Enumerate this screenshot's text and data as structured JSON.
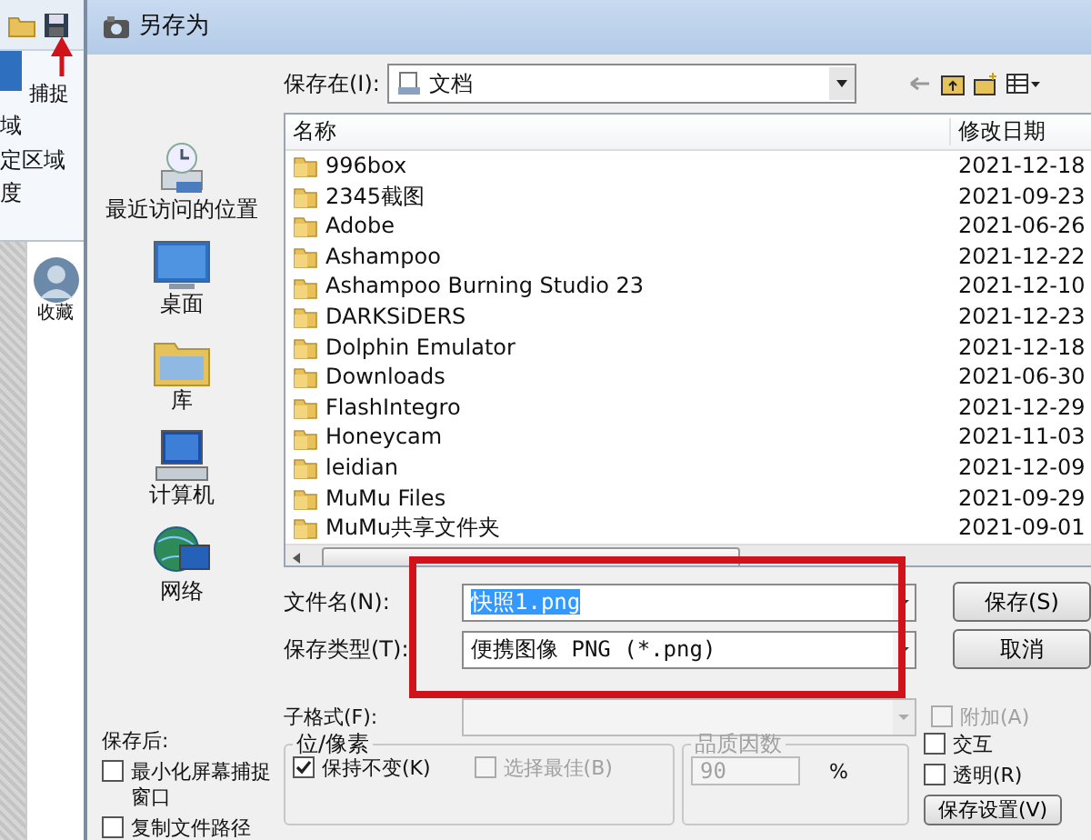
{
  "background_app": {
    "ribbon_texts": [
      "捕捉",
      "域",
      "定区域",
      "度"
    ],
    "panel_caption": "收藏"
  },
  "dialog": {
    "title": "另存为",
    "save_in": {
      "label": "保存在(I):",
      "value": "文档"
    },
    "places": [
      {
        "label": "最近访问的位置",
        "kind": "recent"
      },
      {
        "label": "桌面",
        "kind": "desktop"
      },
      {
        "label": "库",
        "kind": "library"
      },
      {
        "label": "计算机",
        "kind": "computer"
      },
      {
        "label": "网络",
        "kind": "network"
      }
    ],
    "file_list": {
      "columns": [
        "名称",
        "修改日期"
      ],
      "rows": [
        {
          "name": "996box",
          "date": "2021-12-18"
        },
        {
          "name": "2345截图",
          "date": "2021-09-23"
        },
        {
          "name": "Adobe",
          "date": "2021-06-26"
        },
        {
          "name": "Ashampoo",
          "date": "2021-12-22"
        },
        {
          "name": "Ashampoo Burning Studio 23",
          "date": "2021-12-10"
        },
        {
          "name": "DARKSiDERS",
          "date": "2021-12-23"
        },
        {
          "name": "Dolphin Emulator",
          "date": "2021-12-18"
        },
        {
          "name": "Downloads",
          "date": "2021-06-30"
        },
        {
          "name": "FlashIntegro",
          "date": "2021-12-29"
        },
        {
          "name": "Honeycam",
          "date": "2021-11-03"
        },
        {
          "name": "leidian",
          "date": "2021-12-09"
        },
        {
          "name": "MuMu Files",
          "date": "2021-09-29"
        },
        {
          "name": "MuMu共享文件夹",
          "date": "2021-09-01"
        }
      ]
    },
    "file_name": {
      "label": "文件名(N):",
      "value": "快照1.png",
      "text_selected": true
    },
    "save_as_type": {
      "label": "保存类型(T):",
      "value": "便携图像 PNG (*.png)"
    },
    "buttons": [
      {
        "label": "保存(S)"
      },
      {
        "label": "取消"
      }
    ],
    "subformat": {
      "label": "子格式(F):",
      "disabled": true
    },
    "after_save": {
      "label": "保存后:",
      "options": [
        {
          "label": "最小化屏幕捕捉窗口",
          "checked": false
        },
        {
          "label": "复制文件路径",
          "checked": false
        }
      ]
    },
    "bits_per_pixel": {
      "title": "位/像素",
      "options": [
        {
          "label": "保持不变(K)",
          "checked": true,
          "disabled": false
        },
        {
          "label": "选择最佳(B)",
          "checked": false,
          "disabled": true
        }
      ]
    },
    "quality": {
      "title": "品质因数",
      "value": "90",
      "unit": "%",
      "disabled": true
    },
    "side_options": [
      {
        "label": "附加(A)",
        "checked": false,
        "disabled": true
      },
      {
        "label": "交互",
        "checked": false,
        "disabled": false
      },
      {
        "label": "透明(R)",
        "checked": false,
        "disabled": false
      }
    ],
    "save_settings_button": "保存设置(V)"
  }
}
